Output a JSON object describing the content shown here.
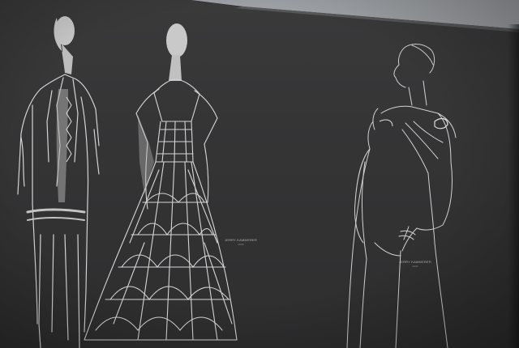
{
  "scene": {
    "description_key": "fashion-illustration-wall",
    "colors": {
      "wall": "#353536",
      "line": "#d8d8d8",
      "silhouette": "#bfbfbf",
      "ceiling": "#a8acb0"
    }
  },
  "signatures": {
    "left": {
      "name": "JERRY KAMMERER",
      "sub": "2006"
    },
    "right": {
      "name": "JERRY KAMMERER",
      "sub": "2006"
    }
  }
}
